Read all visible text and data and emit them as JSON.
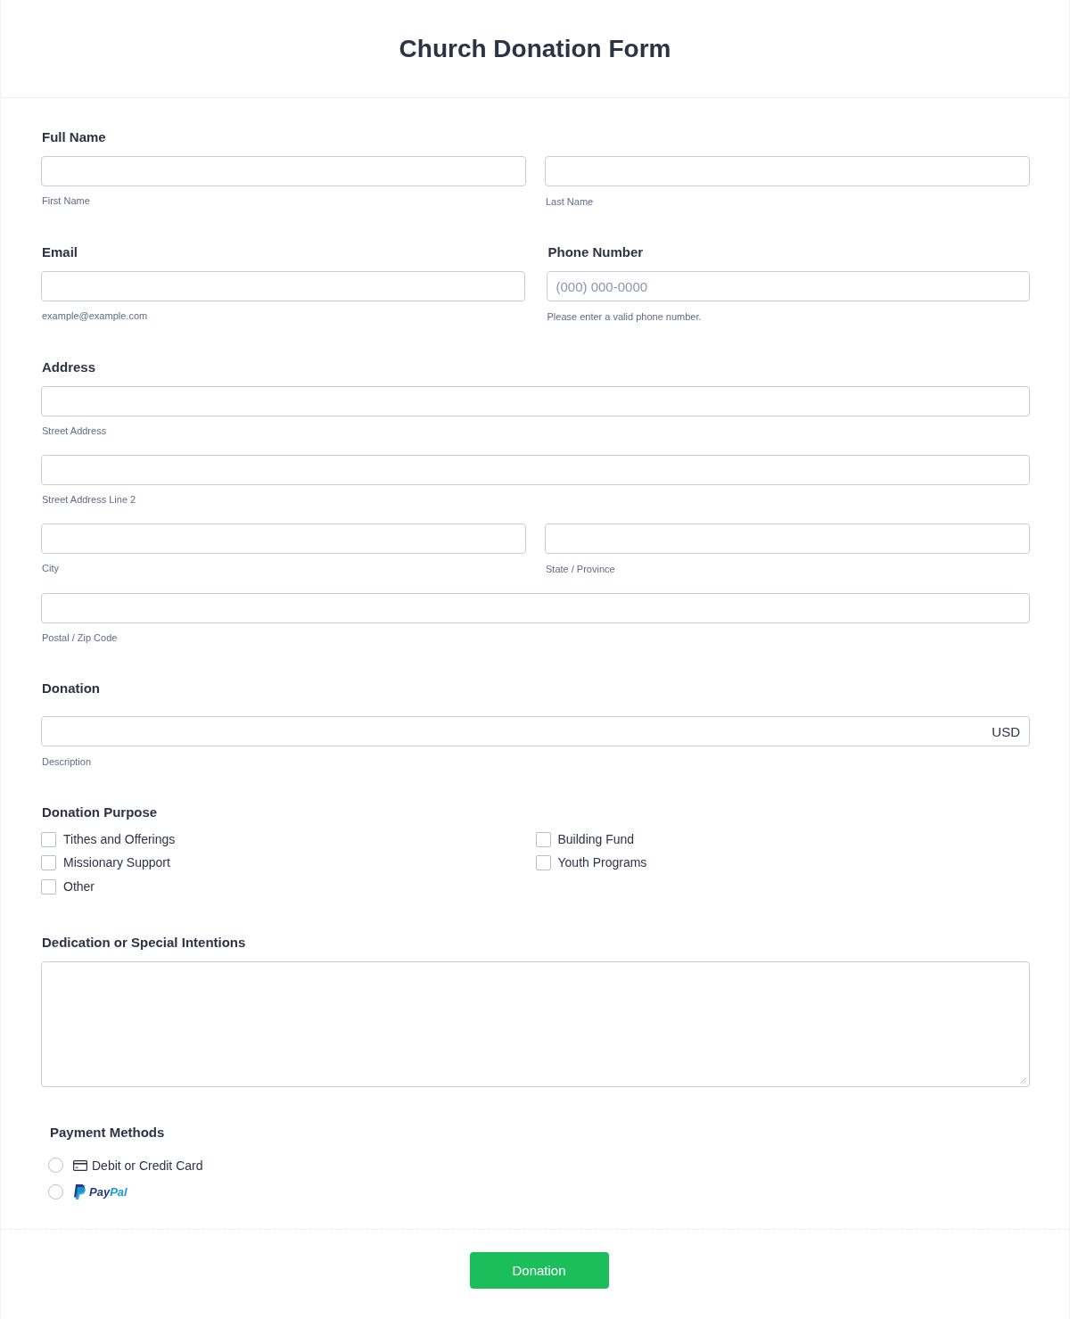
{
  "title": "Church Donation Form",
  "full_name": {
    "label": "Full Name",
    "parts": [
      {
        "sublabel": "First Name"
      },
      {
        "sublabel": "Last Name"
      }
    ]
  },
  "contact": [
    {
      "label": "Email",
      "sublabel": "example@example.com"
    },
    {
      "label": "Phone Number",
      "placeholder": "(000) 000-0000",
      "sublabel": "Please enter a valid phone number."
    }
  ],
  "address": {
    "label": "Address",
    "rows": [
      [
        {
          "sublabel": "Street Address"
        }
      ],
      [
        {
          "sublabel": "Street Address Line 2"
        }
      ],
      [
        {
          "sublabel": "City"
        },
        {
          "sublabel": "State / Province"
        }
      ],
      [
        {
          "sublabel": "Postal / Zip Code"
        }
      ]
    ]
  },
  "donation": {
    "label": "Donation",
    "currency": "USD",
    "sublabel": "Description"
  },
  "donation_purpose": {
    "label": "Donation Purpose",
    "options": [
      {
        "label": "Tithes and Offerings",
        "checked": false
      },
      {
        "label": "Building Fund",
        "checked": false
      },
      {
        "label": "Missionary Support",
        "checked": false
      },
      {
        "label": "Youth Programs",
        "checked": false
      },
      {
        "label": "Other",
        "checked": false
      }
    ]
  },
  "dedication": {
    "label": "Dedication or Special Intentions"
  },
  "payment_methods": {
    "label": "Payment Methods",
    "options": [
      {
        "kind": "card",
        "label": "Debit or Credit Card",
        "selected": false
      },
      {
        "kind": "paypal",
        "logo_parts": [
          "Pay",
          "Pal"
        ],
        "selected": false
      }
    ]
  },
  "submit": {
    "label": "Donation"
  }
}
